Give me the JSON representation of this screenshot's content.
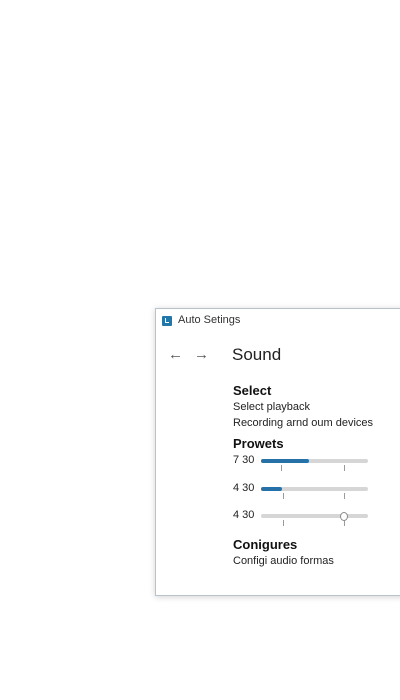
{
  "window": {
    "title": "Auto Setings",
    "page_title": "Sound"
  },
  "nav": {
    "back_icon": "←",
    "forward_icon": "→"
  },
  "select": {
    "heading": "Select",
    "links": [
      "Select playback",
      "Recording arnd oum devices"
    ]
  },
  "presets": {
    "heading": "Prowets",
    "sliders": [
      {
        "label": "7 30",
        "level": 0.45
      },
      {
        "label": "4 30",
        "level": 0.2
      },
      {
        "label": "4 30",
        "level": 0.78
      }
    ]
  },
  "configure": {
    "heading": "Conigures",
    "link": "Configi audio formas"
  },
  "colors": {
    "accent": "#2672a8",
    "track": "#d6d6d6",
    "window_border": "#b9c3cc"
  }
}
